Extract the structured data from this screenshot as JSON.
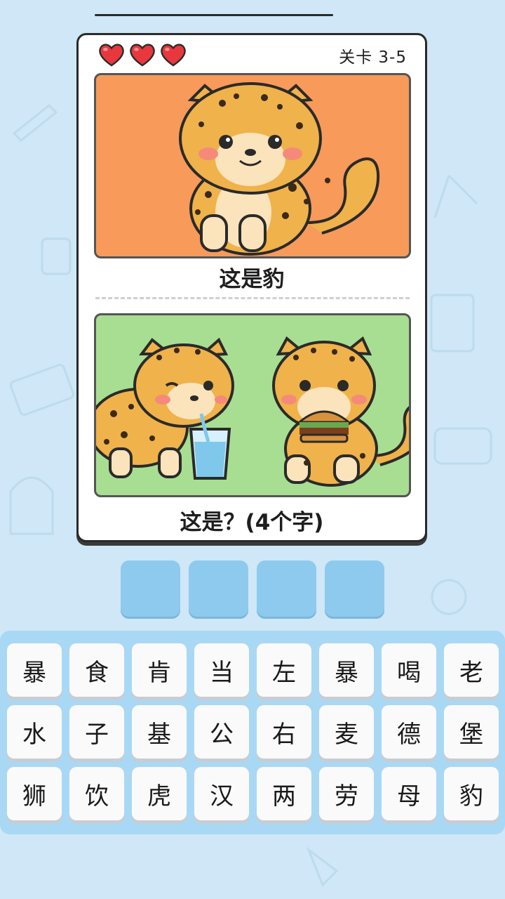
{
  "game": {
    "level_label": "关卡 3-5",
    "lives": 3,
    "colors": {
      "heart": "#e8383d",
      "panel_top": "#f79a5a",
      "panel_bottom": "#a8de92",
      "slot": "#8ecaee"
    }
  },
  "question": {
    "example_caption": "这是豹",
    "prompt_caption": "这是？(4个字)"
  },
  "answer_slots": [
    "",
    "",
    "",
    ""
  ],
  "keyboard": {
    "keys": [
      "暴",
      "食",
      "肯",
      "当",
      "左",
      "暴",
      "喝",
      "老",
      "水",
      "子",
      "基",
      "公",
      "右",
      "麦",
      "德",
      "堡",
      "狮",
      "饮",
      "虎",
      "汉",
      "两",
      "劳",
      "母",
      "豹"
    ]
  }
}
